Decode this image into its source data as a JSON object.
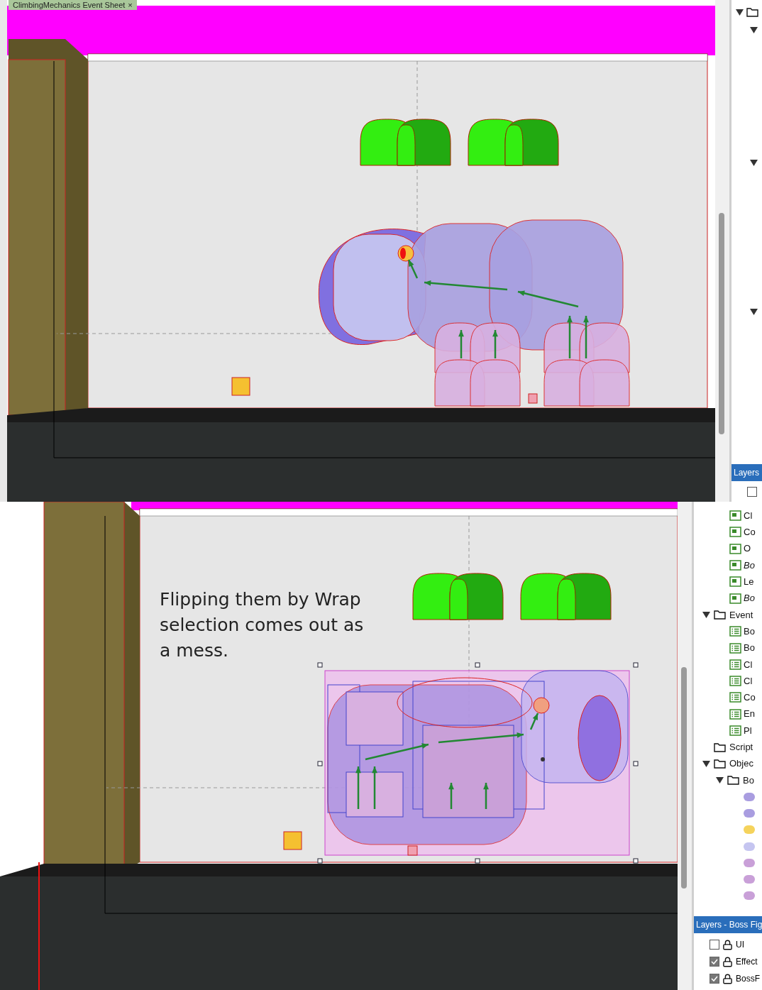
{
  "top": {
    "tab": {
      "label": "ClimbingMechanics Event Sheet",
      "close": "×"
    },
    "tree": [
      {
        "expanded": true
      },
      {
        "expanded": true
      },
      {
        "expanded": true
      },
      {
        "expanded": true
      }
    ],
    "layers_panel": {
      "title": "Layers",
      "rows": [
        {
          "checked": false
        }
      ]
    }
  },
  "bottom": {
    "annotation": "Flipping them by Wrap selection comes out as a mess.",
    "tree": [
      {
        "kind": "layout",
        "label": "Cl",
        "italic": false
      },
      {
        "kind": "layout",
        "label": "Co",
        "italic": false
      },
      {
        "kind": "layout",
        "label": "O",
        "italic": false
      },
      {
        "kind": "layout",
        "label": "Bo",
        "italic": true
      },
      {
        "kind": "layout",
        "label": "Le",
        "italic": false
      },
      {
        "kind": "layout",
        "label": "Bo",
        "italic": true
      },
      {
        "kind": "folder",
        "label": "Event",
        "expanded": true,
        "children": [
          {
            "kind": "events",
            "label": "Bo"
          },
          {
            "kind": "events",
            "label": "Bo"
          },
          {
            "kind": "events",
            "label": "Cl"
          },
          {
            "kind": "events",
            "label": "Cl"
          },
          {
            "kind": "events",
            "label": "Co"
          },
          {
            "kind": "events",
            "label": "En"
          },
          {
            "kind": "events",
            "label": "Pl"
          }
        ]
      },
      {
        "kind": "folder",
        "label": "Script"
      },
      {
        "kind": "folder",
        "label": "Objec",
        "expanded": true,
        "children": [
          {
            "kind": "folder",
            "label": "Bo",
            "expanded": true,
            "children": [
              {
                "kind": "sprite",
                "color": "#a99de0"
              },
              {
                "kind": "sprite",
                "color": "#a99de0"
              },
              {
                "kind": "sprite",
                "color": "#f5d35c"
              },
              {
                "kind": "sprite",
                "color": "#c5c5f0"
              },
              {
                "kind": "sprite",
                "color": "#c9a0d8"
              },
              {
                "kind": "sprite",
                "color": "#c9a0d8"
              },
              {
                "kind": "sprite",
                "color": "#c9a0d8"
              }
            ]
          }
        ]
      }
    ],
    "layers_panel": {
      "title": "Layers - Boss Fig",
      "rows": [
        {
          "name": "UI",
          "checked": false
        },
        {
          "name": "Effect",
          "checked": true
        },
        {
          "name": "BossF",
          "checked": true
        }
      ]
    }
  }
}
